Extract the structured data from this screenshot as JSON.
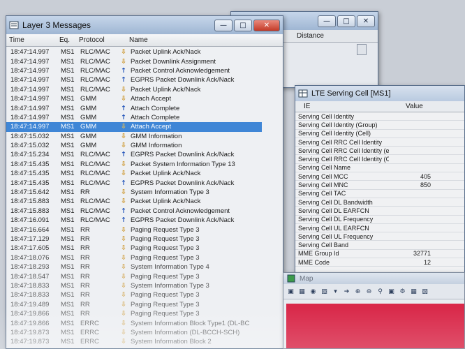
{
  "background_window": {
    "column_distance": "Distance"
  },
  "l3": {
    "title": "Layer 3 Messages",
    "columns": {
      "time": "Time",
      "eq": "Eq.",
      "protocol": "Protocol",
      "name": "Name"
    },
    "rows": [
      {
        "time": "18:47:14.997",
        "eq": "MS1",
        "protocol": "RLC/MAC",
        "dir": "down",
        "name": "Packet Uplink Ack/Nack"
      },
      {
        "time": "18:47:14.997",
        "eq": "MS1",
        "protocol": "RLC/MAC",
        "dir": "down",
        "name": "Packet Downlink Assignment"
      },
      {
        "time": "18:47:14.997",
        "eq": "MS1",
        "protocol": "RLC/MAC",
        "dir": "up",
        "name": "Packet Control Acknowledgement"
      },
      {
        "time": "18:47:14.997",
        "eq": "MS1",
        "protocol": "RLC/MAC",
        "dir": "up",
        "name": "EGPRS Packet Downlink Ack/Nack"
      },
      {
        "time": "18:47:14.997",
        "eq": "MS1",
        "protocol": "RLC/MAC",
        "dir": "down",
        "name": "Packet Uplink Ack/Nack"
      },
      {
        "time": "18:47:14.997",
        "eq": "MS1",
        "protocol": "GMM",
        "dir": "down",
        "name": "Attach Accept"
      },
      {
        "time": "18:47:14.997",
        "eq": "MS1",
        "protocol": "GMM",
        "dir": "up",
        "name": "Attach Complete"
      },
      {
        "time": "18:47:14.997",
        "eq": "MS1",
        "protocol": "GMM",
        "dir": "up",
        "name": "Attach Complete"
      },
      {
        "time": "18:47:14.997",
        "eq": "MS1",
        "protocol": "GMM",
        "dir": "down",
        "name": "Attach Accept",
        "selected": true
      },
      {
        "time": "18:47:15.032",
        "eq": "MS1",
        "protocol": "GMM",
        "dir": "down",
        "name": "GMM Information"
      },
      {
        "time": "18:47:15.032",
        "eq": "MS1",
        "protocol": "GMM",
        "dir": "down",
        "name": "GMM Information"
      },
      {
        "time": "18:47:15.234",
        "eq": "MS1",
        "protocol": "RLC/MAC",
        "dir": "up",
        "name": "EGPRS Packet Downlink Ack/Nack"
      },
      {
        "time": "18:47:15.435",
        "eq": "MS1",
        "protocol": "RLC/MAC",
        "dir": "down",
        "name": "Packet System Information Type 13"
      },
      {
        "time": "18:47:15.435",
        "eq": "MS1",
        "protocol": "RLC/MAC",
        "dir": "down",
        "name": "Packet Uplink Ack/Nack"
      },
      {
        "time": "18:47:15.435",
        "eq": "MS1",
        "protocol": "RLC/MAC",
        "dir": "up",
        "name": "EGPRS Packet Downlink Ack/Nack"
      },
      {
        "time": "18:47:15.642",
        "eq": "MS1",
        "protocol": "RR",
        "dir": "down",
        "name": "System Information Type 3"
      },
      {
        "time": "18:47:15.883",
        "eq": "MS1",
        "protocol": "RLC/MAC",
        "dir": "down",
        "name": "Packet Uplink Ack/Nack"
      },
      {
        "time": "18:47:15.883",
        "eq": "MS1",
        "protocol": "RLC/MAC",
        "dir": "up",
        "name": "Packet Control Acknowledgement"
      },
      {
        "time": "18:47:16.091",
        "eq": "MS1",
        "protocol": "RLC/MAC",
        "dir": "up",
        "name": "EGPRS Packet Downlink Ack/Nack"
      },
      {
        "time": "18:47:16.664",
        "eq": "MS1",
        "protocol": "RR",
        "dir": "down",
        "name": "Paging Request Type 3"
      },
      {
        "time": "18:47:17.129",
        "eq": "MS1",
        "protocol": "RR",
        "dir": "down",
        "name": "Paging Request Type 3"
      },
      {
        "time": "18:47:17.605",
        "eq": "MS1",
        "protocol": "RR",
        "dir": "down",
        "name": "Paging Request Type 3"
      },
      {
        "time": "18:47:18.076",
        "eq": "MS1",
        "protocol": "RR",
        "dir": "down",
        "name": "Paging Request Type 3"
      },
      {
        "time": "18:47:18.293",
        "eq": "MS1",
        "protocol": "RR",
        "dir": "down",
        "name": "System Information Type 4"
      },
      {
        "time": "18:47:18.547",
        "eq": "MS1",
        "protocol": "RR",
        "dir": "down",
        "name": "Paging Request Type 3"
      },
      {
        "time": "18:47:18.833",
        "eq": "MS1",
        "protocol": "RR",
        "dir": "down",
        "name": "System Information Type 3"
      },
      {
        "time": "18:47:18.833",
        "eq": "MS1",
        "protocol": "RR",
        "dir": "down",
        "name": "Paging Request Type 3"
      },
      {
        "time": "18:47:19.489",
        "eq": "MS1",
        "protocol": "RR",
        "dir": "down",
        "name": "Paging Request Type 3"
      },
      {
        "time": "18:47:19.866",
        "eq": "MS1",
        "protocol": "RR",
        "dir": "down",
        "name": "Paging Request Type 3"
      },
      {
        "time": "18:47:19.866",
        "eq": "MS1",
        "protocol": "ERRC",
        "dir": "down",
        "name": "System Information Block Type1 (DL-BC"
      },
      {
        "time": "18:47:19.873",
        "eq": "MS1",
        "protocol": "ERRC",
        "dir": "down",
        "name": "System Information (DL-BCCH-SCH)"
      },
      {
        "time": "18:47:19.873",
        "eq": "MS1",
        "protocol": "ERRC",
        "dir": "down",
        "name": "System Information Block 2"
      }
    ]
  },
  "lte": {
    "title": "LTE Serving Cell [MS1]",
    "columns": {
      "ie": "IE",
      "value": "Value"
    },
    "rows": [
      {
        "ie": "Serving Cell Identity",
        "value": ""
      },
      {
        "ie": "Serving Cell Identity (Group)",
        "value": ""
      },
      {
        "ie": "Serving Cell Identity (Cell)",
        "value": ""
      },
      {
        "ie": "Serving Cell RRC Cell Identity",
        "value": ""
      },
      {
        "ie": "Serving Cell RRC Cell Identity (eNo...",
        "value": ""
      },
      {
        "ie": "Serving Cell RRC Cell Identity (Cell)",
        "value": ""
      },
      {
        "ie": "Serving Cell Name",
        "value": ""
      },
      {
        "ie": "Serving Cell MCC",
        "value": "405"
      },
      {
        "ie": "Serving Cell MNC",
        "value": "850"
      },
      {
        "ie": "Serving Cell TAC",
        "value": ""
      },
      {
        "ie": "Serving Cell DL Bandwidth",
        "value": ""
      },
      {
        "ie": "Serving Cell DL EARFCN",
        "value": ""
      },
      {
        "ie": "Serving Cell DL Frequency",
        "value": ""
      },
      {
        "ie": "Serving Cell UL EARFCN",
        "value": ""
      },
      {
        "ie": "Serving Cell UL Frequency",
        "value": ""
      },
      {
        "ie": "Serving Cell Band",
        "value": ""
      },
      {
        "ie": "MME Group Id",
        "value": "32771"
      },
      {
        "ie": "MME Code",
        "value": "12"
      }
    ]
  },
  "map": {
    "title": "Map",
    "canvas_color": "#d9294a"
  },
  "colors": {
    "selection": "#3f86d6",
    "uplink_arrow": "#1c4fb8",
    "downlink_arrow": "#c98b12",
    "close_button": "#c33a27"
  }
}
